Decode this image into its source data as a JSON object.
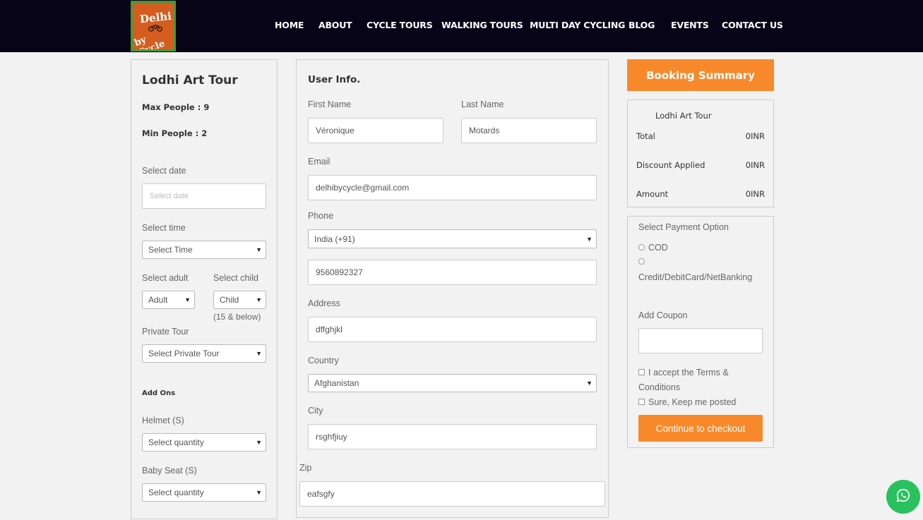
{
  "logo": {
    "line1": "Delhi",
    "line2": "by Cycle"
  },
  "nav": [
    "HOME",
    "ABOUT",
    "CYCLE TOURS",
    "WALKING TOURS",
    "MULTI DAY CYCLING",
    "BLOG",
    "EVENTS",
    "CONTACT US"
  ],
  "tour": {
    "title": "Lodhi Art Tour",
    "max_people": "Max People : 9",
    "min_people": "Min People : 2",
    "date_label": "Select date",
    "date_placeholder": "Select date",
    "time_label": "Select time",
    "time_value": "Select Time",
    "adult_label": "Select adult",
    "adult_value": "Adult",
    "child_label": "Select child",
    "child_value": "Child",
    "child_note": "(15 & below)",
    "private_label": "Private Tour",
    "private_value": "Select Private Tour",
    "addons_label": "Add Ons",
    "helmet_label": "Helmet (S)",
    "helmet_value": "Select quantity",
    "babyseat_label": "Baby Seat (S)",
    "babyseat_value": "Select quantity"
  },
  "user": {
    "heading": "User Info.",
    "first_name_label": "First Name",
    "first_name": "Véronique",
    "last_name_label": "Last Name",
    "last_name": "Motards",
    "email_label": "Email",
    "email": "delhibycycle@gmail.com",
    "phone_label": "Phone",
    "phone_country": "India (+91)",
    "phone": "9560892327",
    "address_label": "Address",
    "address": "dffghjkl",
    "country_label": "Country",
    "country": "Afghanistan",
    "city_label": "City",
    "city": "rsghfjiuy",
    "zip_label": "Zip",
    "zip": "eafsgfy"
  },
  "summary": {
    "button": "Booking Summary",
    "tour_name": "Lodhi Art Tour",
    "total_label": "Total",
    "total_value": "0INR",
    "discount_label": "Discount Applied",
    "discount_value": "0INR",
    "amount_label": "Amount",
    "amount_value": "0INR"
  },
  "payment": {
    "heading": "Select Payment Option",
    "option_cod": "COD",
    "option_card": "Credit/DebitCard/NetBanking",
    "coupon_label": "Add Coupon",
    "terms_line1": "I accept the Terms &",
    "terms_line2": "Conditions",
    "keep_posted": "Sure, Keep me posted",
    "checkout": "Continue to checkout"
  },
  "colors": {
    "navbar": "#070418",
    "accent": "#f7892b",
    "whatsapp": "#29c15e"
  },
  "icons": {
    "whatsapp": "whatsapp-icon",
    "dropdown": "chevron-down-icon"
  }
}
